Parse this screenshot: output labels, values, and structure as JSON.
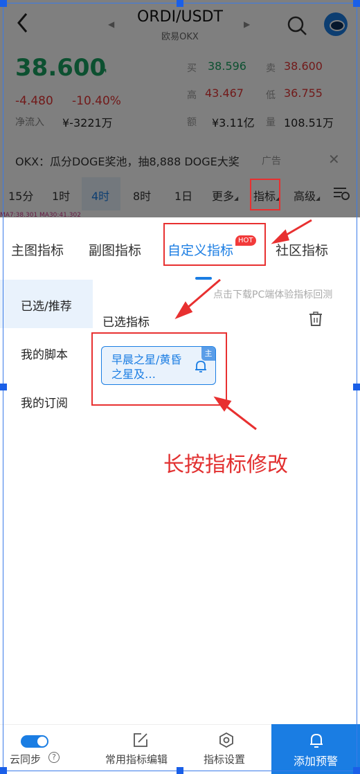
{
  "header": {
    "pair": "ORDI/USDT",
    "exchange": "欧易OKX",
    "prev_arrow": "◀",
    "next_arrow": "▶"
  },
  "ticker": {
    "price": "38.600",
    "change": "-4.480",
    "change_pct": "-10.40%",
    "net_flow_label": "净流入",
    "net_flow_value": "¥-3221万",
    "buy_label": "买",
    "buy_value": "38.596",
    "sell_label": "卖",
    "sell_value": "38.600",
    "high_label": "高",
    "high_value": "43.467",
    "low_label": "低",
    "low_value": "36.755",
    "amount_label": "额",
    "amount_value": "¥3.11亿",
    "volume_label": "量",
    "volume_value": "108.51万"
  },
  "ad": {
    "text": "OKX：瓜分DOGE奖池，抽8,888 DOGE大奖",
    "tag": "广告",
    "close": "✕"
  },
  "timeframes": {
    "items": [
      "15分",
      "1时",
      "4时",
      "8时",
      "1日"
    ],
    "more": "更多",
    "indicator": "指标",
    "advanced": "高级",
    "ma_row": "MA7:38.301  MA30:41.302"
  },
  "panel": {
    "tabs": [
      "主图指标",
      "副图指标",
      "自定义指标",
      "社区指标"
    ],
    "hot_badge": "HOT",
    "sidebar": [
      "已选/推荐",
      "我的脚本",
      "我的订阅"
    ],
    "hint": "点击下载PC端体验指标回测",
    "selected_title": "已选指标",
    "card_text": "早晨之星/黄昏之星及…",
    "card_badge": "主",
    "annotation": "长按指标修改"
  },
  "bottom": {
    "sync_label": "云同步",
    "help": "?",
    "edit_label": "常用指标编辑",
    "settings_label": "指标设置",
    "add_alert_label": "添加预警"
  },
  "colors": {
    "accent": "#1a7de3",
    "up": "#18a060",
    "down": "#e23434",
    "annotation": "#e83030"
  }
}
